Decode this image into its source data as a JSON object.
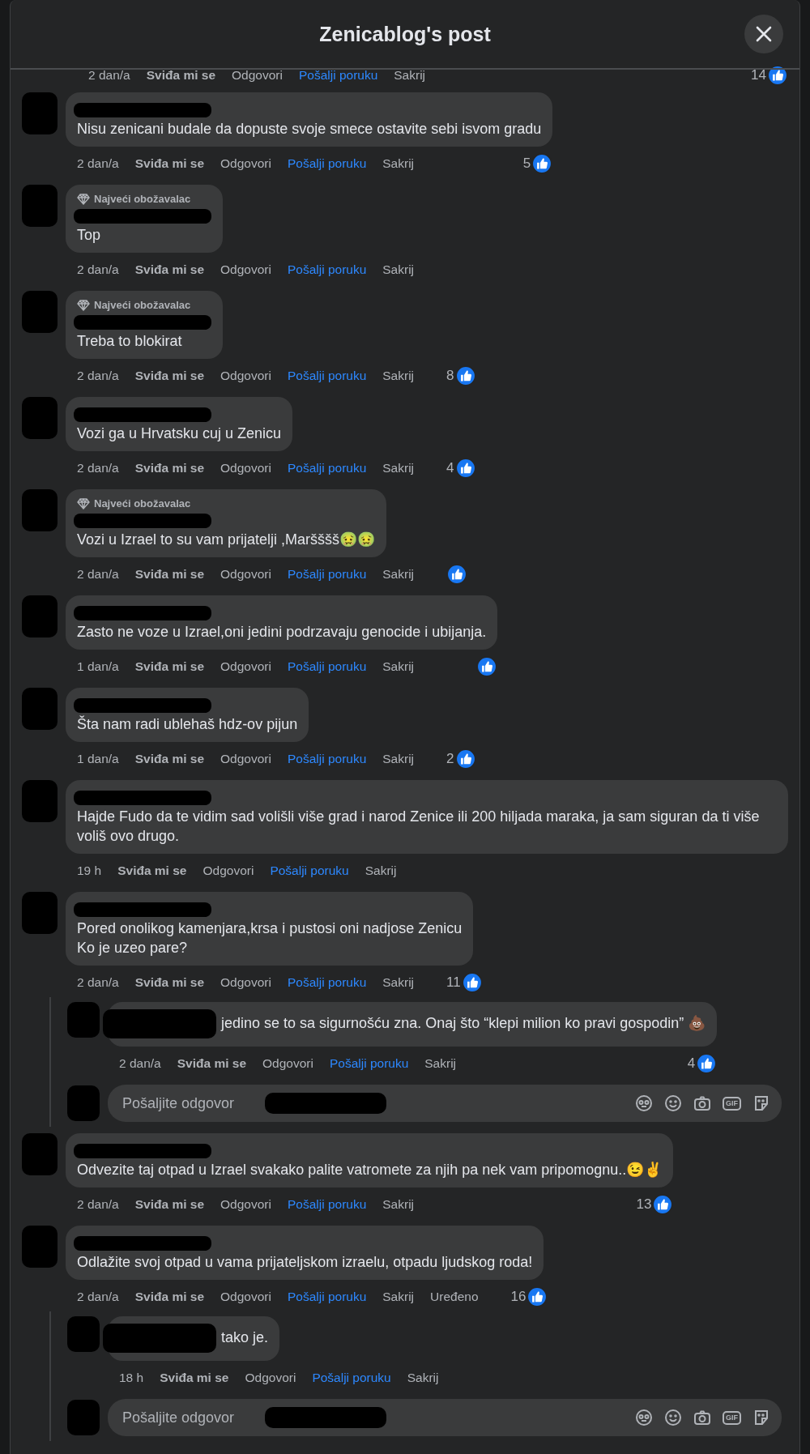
{
  "dialog": {
    "title": "Zenicablog's post"
  },
  "comments": [
    {
      "kind": "cut",
      "time": "2 dan/a",
      "actions": [
        "Sviđa mi se",
        "Odgovori",
        "Pošalji poruku",
        "Sakrij"
      ],
      "likes": "14",
      "reacted": true
    },
    {
      "kind": "comment",
      "text": "Nisu zenicani budale da dopuste svoje smece ostavite sebi isvom gradu",
      "time": "2 dan/a",
      "actions": [
        "Sviđa mi se",
        "Odgovori",
        "Pošalji poruku",
        "Sakrij"
      ],
      "likes": "5",
      "reacted": true
    },
    {
      "kind": "comment",
      "badge": "Najveći obožavalac",
      "text": "Top",
      "time": "2 dan/a",
      "actions": [
        "Sviđa mi se",
        "Odgovori",
        "Pošalji poruku",
        "Sakrij"
      ],
      "reacted": false
    },
    {
      "kind": "comment",
      "badge": "Najveći obožavalac",
      "text": "Treba to blokirat",
      "time": "2 dan/a",
      "actions": [
        "Sviđa mi se",
        "Odgovori",
        "Pošalji poruku",
        "Sakrij"
      ],
      "likes": "8",
      "reacted": true
    },
    {
      "kind": "comment",
      "text": "Vozi ga u Hrvatsku cuj u Zenicu",
      "time": "2 dan/a",
      "actions": [
        "Sviđa mi se",
        "Odgovori",
        "Pošalji poruku",
        "Sakrij"
      ],
      "likes": "4",
      "reacted": true
    },
    {
      "kind": "comment",
      "badge": "Najveći obožavalac",
      "text": "Vozi u Izrael to su vam prijatelji ,Maršššš🤢🤢",
      "time": "2 dan/a",
      "actions": [
        "Sviđa mi se",
        "Odgovori",
        "Pošalji poruku",
        "Sakrij"
      ],
      "reacted": true
    },
    {
      "kind": "comment",
      "text": "Zasto ne voze u Izrael,oni jedini podrzavaju genocide i ubijanja.",
      "time": "1 dan/a",
      "actions": [
        "Sviđa mi se",
        "Odgovori",
        "Pošalji poruku",
        "Sakrij"
      ],
      "reacted": true
    },
    {
      "kind": "comment",
      "text": "Šta nam radi ublehaš hdz-ov pijun",
      "time": "1 dan/a",
      "actions": [
        "Sviđa mi se",
        "Odgovori",
        "Pošalji poruku",
        "Sakrij"
      ],
      "likes": "2",
      "reacted": true
    },
    {
      "kind": "comment",
      "text": "Hajde Fudo da te vidim sad volišli više grad i narod Zenice ili 200 hiljada maraka, ja sam siguran da ti više voliš ovo drugo.",
      "time": "19 h",
      "actions": [
        "Sviđa mi se",
        "Odgovori",
        "Pošalji poruku",
        "Sakrij"
      ],
      "reacted": false
    },
    {
      "kind": "comment",
      "text": "Pored onolikog kamenjara,krsa i pustosi oni nadjose Zenicu\nKo je uzeo pare?",
      "time": "2 dan/a",
      "actions": [
        "Sviđa mi se",
        "Odgovori",
        "Pošalji poruku",
        "Sakrij"
      ],
      "likes": "11",
      "reacted": true,
      "children": [
        {
          "kind": "comment",
          "mention_redacted": true,
          "text": "jedino se to sa sigurnošću zna. Onaj što “klepi milion ko pravi gospodin” 💩",
          "time": "2 dan/a",
          "actions": [
            "Sviđa mi se",
            "Odgovori",
            "Pošalji poruku",
            "Sakrij"
          ],
          "likes": "4",
          "reacted": true
        },
        {
          "kind": "reply_box",
          "placeholder": "Pošaljite odgovor",
          "gif_label": "GIF"
        }
      ]
    },
    {
      "kind": "comment",
      "text": "Odvezite taj otpad u Izrael svakako palite vatromete za njih pa nek vam pripomognu..😉✌️",
      "time": "2 dan/a",
      "actions": [
        "Sviđa mi se",
        "Odgovori",
        "Pošalji poruku",
        "Sakrij"
      ],
      "likes": "13",
      "reacted": true
    },
    {
      "kind": "comment",
      "text": "Odlažite svoj otpad u vama prijateljskom izraelu, otpadu ljudskog roda!",
      "time": "2 dan/a",
      "actions": [
        "Sviđa mi se",
        "Odgovori",
        "Pošalji poruku",
        "Sakrij"
      ],
      "edited": "Uređeno",
      "likes": "16",
      "reacted": true,
      "children": [
        {
          "kind": "comment",
          "mention_redacted": true,
          "text": "tako je.",
          "time": "18 h",
          "actions": [
            "Sviđa mi se",
            "Odgovori",
            "Pošalji poruku",
            "Sakrij"
          ],
          "reacted": false
        },
        {
          "kind": "reply_box",
          "placeholder": "Pošaljite odgovor",
          "gif_label": "GIF"
        }
      ]
    }
  ]
}
